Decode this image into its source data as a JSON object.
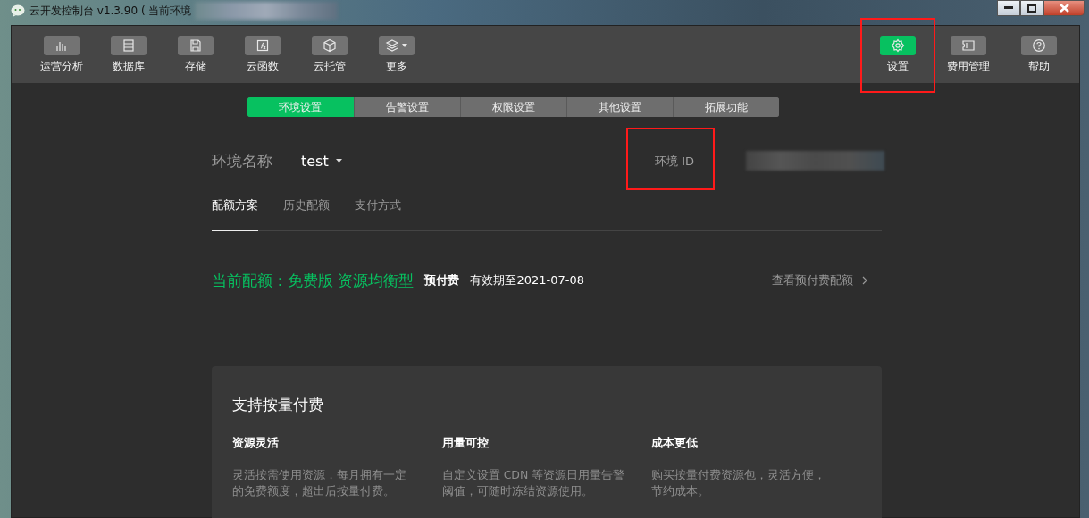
{
  "window": {
    "title": "云开发控制台 v1.3.90 ( 当前环境"
  },
  "toolbar_left": [
    {
      "label": "运营分析",
      "selected": false,
      "highlighted": false,
      "dropdown": false
    },
    {
      "label": "数据库",
      "selected": false,
      "highlighted": false,
      "dropdown": false
    },
    {
      "label": "存储",
      "selected": false,
      "highlighted": false,
      "dropdown": false
    },
    {
      "label": "云函数",
      "selected": false,
      "highlighted": false,
      "dropdown": false
    },
    {
      "label": "云托管",
      "selected": false,
      "highlighted": false,
      "dropdown": false
    },
    {
      "label": "更多",
      "selected": false,
      "highlighted": false,
      "dropdown": true
    }
  ],
  "toolbar_right": [
    {
      "label": "设置",
      "selected": true,
      "highlighted": true,
      "dropdown": false
    },
    {
      "label": "费用管理",
      "selected": false,
      "highlighted": false,
      "dropdown": false
    },
    {
      "label": "帮助",
      "selected": false,
      "highlighted": false,
      "dropdown": false
    }
  ],
  "tabs": [
    {
      "label": "环境设置",
      "selected": true
    },
    {
      "label": "告警设置",
      "selected": false
    },
    {
      "label": "权限设置",
      "selected": false
    },
    {
      "label": "其他设置",
      "selected": false
    },
    {
      "label": "拓展功能",
      "selected": false
    }
  ],
  "environment": {
    "label": "环境名称",
    "value": "test",
    "id_label": "环境 ID",
    "id_highlighted": true
  },
  "subtabs": [
    {
      "label": "配额方案",
      "selected": true
    },
    {
      "label": "历史配额",
      "selected": false
    },
    {
      "label": "支付方式",
      "selected": false
    }
  ],
  "quota": {
    "title": "当前配额：免费版 资源均衡型",
    "payment": "预付费",
    "expiry": "有效期至2021-07-08",
    "link": "查看预付费配额"
  },
  "card": {
    "title": "支持按量付费",
    "features": [
      {
        "title": "资源灵活",
        "text": "灵活按需使用资源，每月拥有一定的免费额度，超出后按量付费。"
      },
      {
        "title": "用量可控",
        "text": "自定义设置 CDN 等资源日用量告警阈值，可随时冻结资源使用。"
      },
      {
        "title": "成本更低",
        "text": "购买按量付费资源包，灵活方便，节约成本。"
      }
    ]
  }
}
